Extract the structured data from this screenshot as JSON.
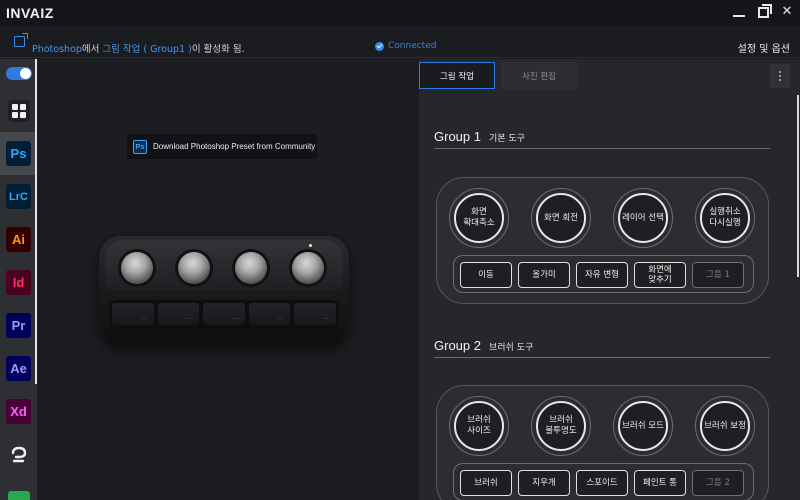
{
  "app": {
    "logo": "INVAIZ"
  },
  "window": {
    "close_glyph": "✕"
  },
  "status": {
    "app_name": "Photoshop",
    "msg_part1": "에서 ",
    "workspace": "그림 작업 ( Group1 )",
    "msg_part2": "이 활성화 됨.",
    "connection": "Connected",
    "settings_label": "설정 및 옵션"
  },
  "sidebar": {
    "apps": [
      {
        "label": "Ps",
        "color": "#31a8ff",
        "bg": "#001e36"
      },
      {
        "label": "LrC",
        "color": "#31a8ff",
        "bg": "#001e36"
      },
      {
        "label": "Ai",
        "color": "#ff9a00",
        "bg": "#330000"
      },
      {
        "label": "Id",
        "color": "#ff3366",
        "bg": "#49021f"
      },
      {
        "label": "Pr",
        "color": "#9999ff",
        "bg": "#00005b"
      },
      {
        "label": "Ae",
        "color": "#9999ff",
        "bg": "#00005b"
      },
      {
        "label": "Xd",
        "color": "#ff61f6",
        "bg": "#470137"
      }
    ]
  },
  "middle": {
    "download_label": "Download Photoshop Preset from Community",
    "ps_mini": "Ps"
  },
  "tabs": {
    "active": "그림 작업",
    "inactive": "사진 편집"
  },
  "groups": [
    {
      "title": "Group 1",
      "subtitle": "기본 도구",
      "circles": [
        "화면\n확대축소",
        "화면 회전",
        "레이어 선택",
        "실행취소\n다시실행"
      ],
      "buttons": [
        "이동",
        "올가미",
        "자유 변형",
        "화면에\n맞추기",
        "그룹 1"
      ]
    },
    {
      "title": "Group 2",
      "subtitle": "브러쉬 도구",
      "circles": [
        "브러쉬\n사이즈",
        "브러쉬\n불투명도",
        "브러쉬 모드",
        "브러쉬 보정"
      ],
      "buttons": [
        "브러쉬",
        "지우개",
        "스포이드",
        "페인트 통",
        "그룹 2"
      ]
    }
  ]
}
